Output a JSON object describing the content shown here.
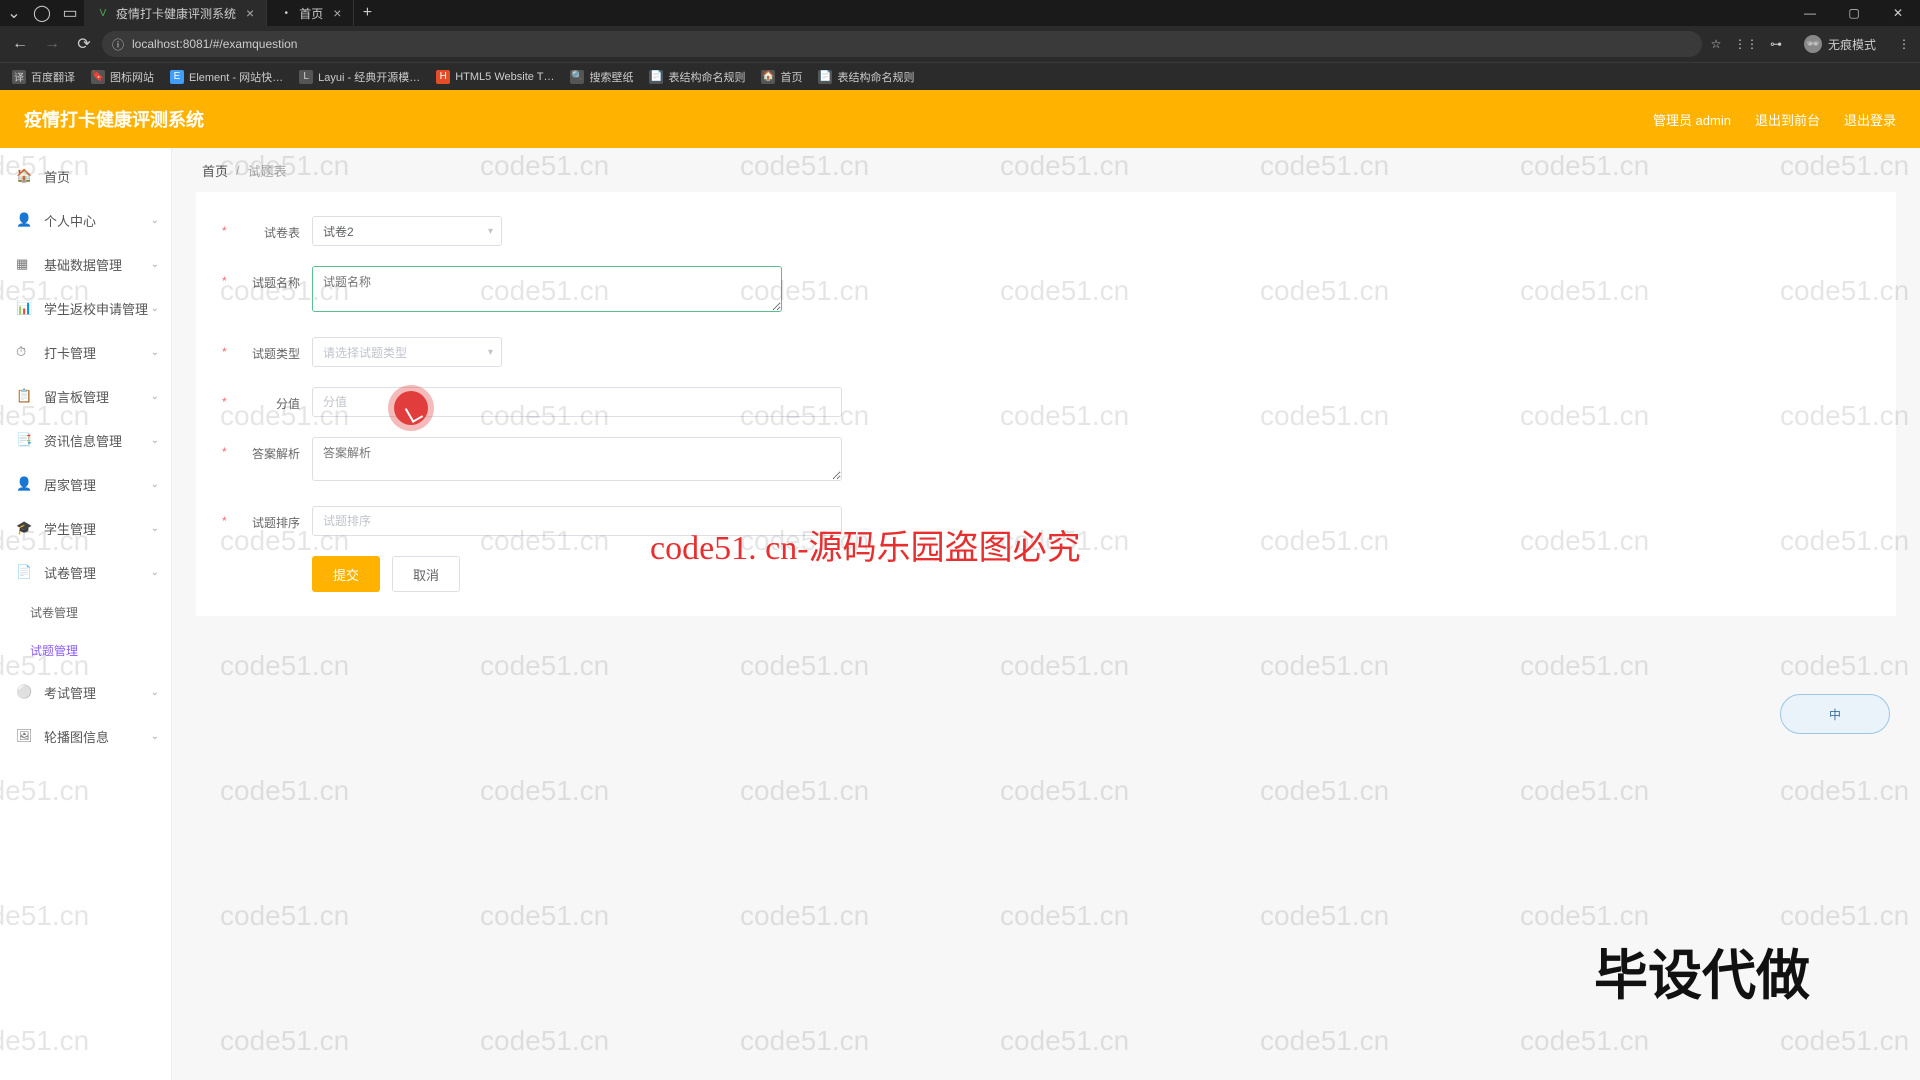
{
  "browser": {
    "tabs": [
      {
        "favicon": "V",
        "title": "疫情打卡健康评测系统",
        "active": true
      },
      {
        "favicon": "•",
        "title": "首页",
        "active": false
      }
    ],
    "url": "localhost:8081/#/examquestion",
    "incognito_label": "无痕模式",
    "bookmarks": [
      {
        "icon": "译",
        "label": "百度翻译"
      },
      {
        "icon": "🔖",
        "label": "图标网站"
      },
      {
        "icon": "E",
        "label": "Element - 网站快…"
      },
      {
        "icon": "L",
        "label": "Layui - 经典开源模…"
      },
      {
        "icon": "H",
        "label": "HTML5 Website T…"
      },
      {
        "icon": "🔍",
        "label": "搜索壁纸"
      },
      {
        "icon": "📄",
        "label": "表结构命名规则"
      },
      {
        "icon": "🏠",
        "label": "首页"
      },
      {
        "icon": "📄",
        "label": "表结构命名规则"
      }
    ]
  },
  "header": {
    "app_title": "疫情打卡健康评测系统",
    "admin_label": "管理员 admin",
    "back_label": "退出到前台",
    "logout_label": "退出登录"
  },
  "sidebar": {
    "items": [
      {
        "icon": "🏠",
        "label": "首页",
        "expand": false,
        "children": []
      },
      {
        "icon": "👤",
        "label": "个人中心",
        "expand": true,
        "children": []
      },
      {
        "icon": "▦",
        "label": "基础数据管理",
        "expand": true,
        "children": []
      },
      {
        "icon": "📊",
        "label": "学生返校申请管理",
        "expand": true,
        "children": []
      },
      {
        "icon": "⏱",
        "label": "打卡管理",
        "expand": true,
        "children": []
      },
      {
        "icon": "📋",
        "label": "留言板管理",
        "expand": true,
        "children": []
      },
      {
        "icon": "📑",
        "label": "资讯信息管理",
        "expand": true,
        "children": []
      },
      {
        "icon": "👤",
        "label": "居家管理",
        "expand": true,
        "children": []
      },
      {
        "icon": "🎓",
        "label": "学生管理",
        "expand": true,
        "children": []
      },
      {
        "icon": "📄",
        "label": "试卷管理",
        "expand": true,
        "children": [
          {
            "label": "试卷管理",
            "active": false
          },
          {
            "label": "试题管理",
            "active": true
          }
        ]
      },
      {
        "icon": "⚪",
        "label": "考试管理",
        "expand": true,
        "children": []
      },
      {
        "icon": "🖼",
        "label": "轮播图信息",
        "expand": true,
        "children": []
      }
    ]
  },
  "breadcrumb": {
    "home": "首页",
    "current": "试题表"
  },
  "form": {
    "paper_label": "试卷表",
    "paper_value": "试卷2",
    "name_label": "试题名称",
    "name_value": "",
    "name_placeholder": "试题名称",
    "type_label": "试题类型",
    "type_placeholder": "请选择试题类型",
    "score_label": "分值",
    "score_placeholder": "分值",
    "analysis_label": "答案解析",
    "analysis_placeholder": "答案解析",
    "order_label": "试题排序",
    "order_placeholder": "试题排序",
    "submit_label": "提交",
    "cancel_label": "取消"
  },
  "watermark": {
    "text": "code51.cn",
    "center": "code51. cn-源码乐园盗图必究",
    "corner": "毕设代做"
  },
  "ime": {
    "label": "中"
  }
}
